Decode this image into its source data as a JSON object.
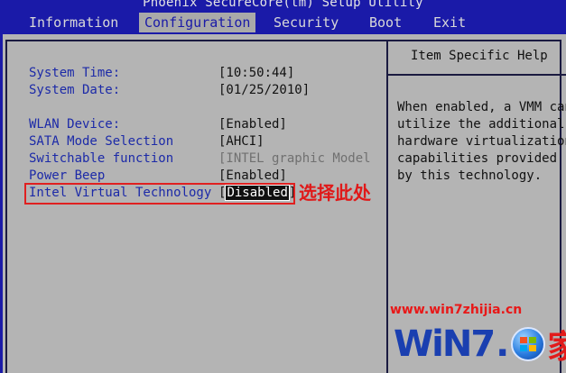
{
  "window": {
    "title": "Phoenix SecureCore(tm) Setup Utility"
  },
  "menu": {
    "items": [
      {
        "label": "Information"
      },
      {
        "label": "Configuration",
        "active": true
      },
      {
        "label": "Security"
      },
      {
        "label": "Boot"
      },
      {
        "label": "Exit"
      }
    ]
  },
  "settings": {
    "system_time": {
      "label": "System Time:",
      "value": "[10:50:44]"
    },
    "system_date": {
      "label": "System Date:",
      "value": "[01/25/2010]"
    },
    "wlan_device": {
      "label": "WLAN Device:",
      "value": "[Enabled]"
    },
    "sata_mode": {
      "label": "SATA Mode Selection",
      "value": "[AHCI]"
    },
    "switchable": {
      "label": "Switchable function",
      "value": "[INTEL graphic Model"
    },
    "power_beep": {
      "label": "Power Beep",
      "value": "[Enabled]"
    },
    "intel_vt": {
      "label": "Intel Virtual Technology",
      "value_open": "[",
      "value": "Disabled",
      "value_close": "]"
    }
  },
  "help": {
    "title": "Item Specific Help",
    "lines": [
      "When enabled, a VMM can",
      "utilize the additional",
      "hardware virtualization",
      "capabilities provided",
      "by this technology."
    ]
  },
  "annotation": {
    "text": "选择此处",
    "color": "#e01818"
  },
  "watermark": {
    "url": "www.win7zhijia.cn",
    "logo_text_a": "WiN",
    "logo_text_b": "7.",
    "logo_text_c": "家"
  },
  "colors": {
    "bios_blue": "#1a1aa8",
    "panel_gray": "#b4b4b4",
    "label_blue": "#1c2aa8"
  }
}
